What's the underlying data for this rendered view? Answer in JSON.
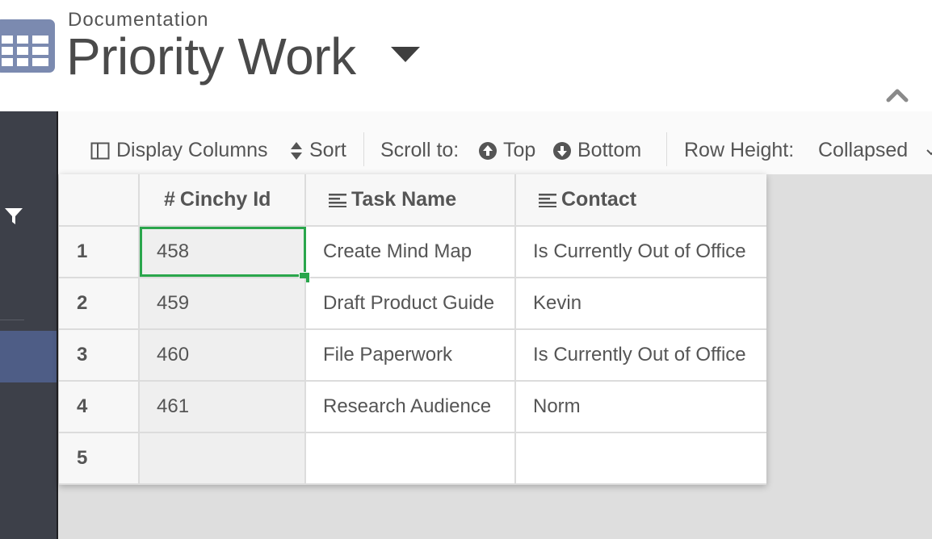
{
  "header": {
    "subtitle": "Documentation",
    "title": "Priority Work",
    "icon": "table-grid-icon",
    "accent_color": "#7b8ab0"
  },
  "toolbar": {
    "display_columns": "Display Columns",
    "sort": "Sort",
    "scroll_to": "Scroll to:",
    "top": "Top",
    "bottom": "Bottom",
    "row_height_label": "Row Height:",
    "row_height_value": "Collapsed"
  },
  "table": {
    "columns": [
      {
        "label": "Cinchy Id",
        "icon": "hash-icon"
      },
      {
        "label": "Task Name",
        "icon": "text-lines-icon"
      },
      {
        "label": "Contact",
        "icon": "text-lines-icon"
      }
    ],
    "rows": [
      {
        "num": "1",
        "id": "458",
        "task": "Create Mind Map",
        "contact": "Is Currently Out of Office"
      },
      {
        "num": "2",
        "id": "459",
        "task": "Draft Product Guide",
        "contact": "Kevin"
      },
      {
        "num": "3",
        "id": "460",
        "task": "File Paperwork",
        "contact": "Is Currently Out of Office"
      },
      {
        "num": "4",
        "id": "461",
        "task": "Research Audience",
        "contact": "Norm"
      },
      {
        "num": "5",
        "id": "",
        "task": "",
        "contact": ""
      }
    ],
    "selection_color": "#2aa64c"
  }
}
